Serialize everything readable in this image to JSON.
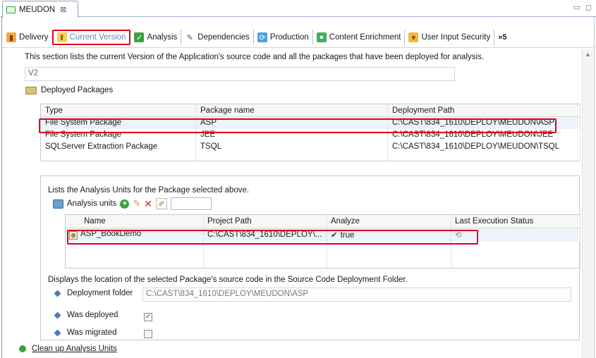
{
  "editor": {
    "tab_title": "MEUDON",
    "close_glyph": "⊠",
    "window_controls": "▭ ◻"
  },
  "subtabs": [
    {
      "label": "Delivery",
      "icon": "truck-icon"
    },
    {
      "label": "Current Version",
      "icon": "version-icon"
    },
    {
      "label": "Analysis",
      "icon": "analysis-icon"
    },
    {
      "label": "Dependencies",
      "icon": "dependencies-icon"
    },
    {
      "label": "Production",
      "icon": "production-icon"
    },
    {
      "label": "Content Enrichment",
      "icon": "content-enrichment-icon"
    },
    {
      "label": "User Input Security",
      "icon": "security-icon"
    }
  ],
  "overflow": {
    "label": "»5"
  },
  "intro_text": "This section lists the current Version of the Application's source code and all the packages that have been deployed for analysis.",
  "version_value": "V2",
  "deployed_packages": {
    "title": "Deployed Packages",
    "columns": [
      "Type",
      "Package name",
      "Deployment Path"
    ],
    "rows": [
      [
        "File System Package",
        "ASP",
        "C:\\CAST\\834_1610\\DEPLOY\\MEUDON\\ASP"
      ],
      [
        "File System Package",
        "JEE",
        "C:\\CAST\\834_1610\\DEPLOY\\MEUDON\\JEE"
      ],
      [
        "SQLServer Extraction Package",
        "TSQL",
        "C:\\CAST\\834_1610\\DEPLOY\\MEUDON\\TSQL"
      ]
    ]
  },
  "analysis_units": {
    "description": "Lists the Analysis Units for the Package selected above.",
    "toolbar_label": "Analysis units",
    "columns": [
      "Name",
      "Project Path",
      "Analyze",
      "Last Execution Status"
    ],
    "rows": [
      {
        "name": "ASP_BookDemo",
        "path": "C:\\CAST\\834_1610\\DEPLOY\\...",
        "analyze": "true"
      }
    ]
  },
  "location": {
    "description": "Displays the location of the selected Package's source code in the Source Code Deployment Folder.",
    "deployment_folder_label": "Deployment folder",
    "deployment_folder_value": "C:\\CAST\\834_1610\\DEPLOY\\MEUDON\\ASP",
    "was_deployed_label": "Was deployed",
    "was_deployed_checked": true,
    "was_migrated_label": "Was migrated",
    "was_migrated_checked": false
  },
  "cleanup_link": "Clean up Analysis Units",
  "colors": {
    "highlight": "#e0001b",
    "active_tab_text": "#6d86b3",
    "frame": "#7f9db9"
  }
}
